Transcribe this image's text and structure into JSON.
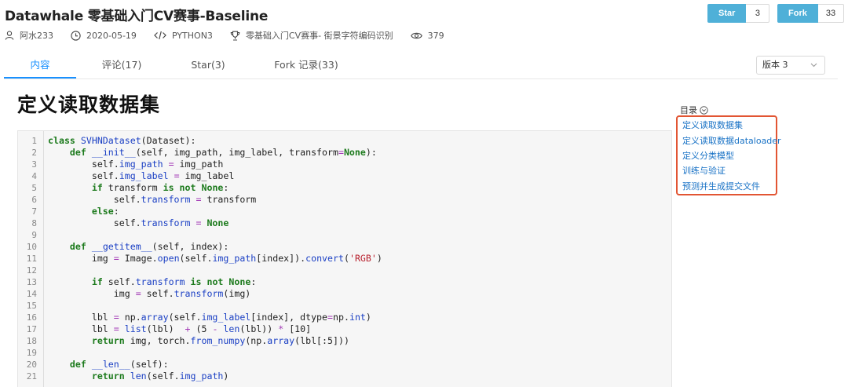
{
  "header": {
    "title": "Datawhale 零基础入门CV赛事-Baseline",
    "star_label": "Star",
    "star_count": "3",
    "fork_label": "Fork",
    "fork_count": "33"
  },
  "meta": {
    "author": "阿水233",
    "date": "2020-05-19",
    "language": "PYTHON3",
    "competition": "零基础入门CV赛事- 街景字符编码识别",
    "views": "379"
  },
  "tabs": [
    {
      "label": "内容",
      "active": true
    },
    {
      "label": "评论(17)",
      "active": false
    },
    {
      "label": "Star(3)",
      "active": false
    },
    {
      "label": "Fork 记录(33)",
      "active": false
    }
  ],
  "version_select": {
    "value": "版本 3"
  },
  "section_heading": "定义读取数据集",
  "toc": {
    "title": "目录",
    "items": [
      "定义读取数据集",
      "定义读取数据dataloader",
      "定义分类模型",
      "训练与验证",
      "预测并生成提交文件"
    ]
  },
  "code": {
    "line_numbers": [
      "1",
      "2",
      "3",
      "4",
      "5",
      "6",
      "7",
      "8",
      "9",
      "10",
      "11",
      "12",
      "13",
      "14",
      "15",
      "16",
      "17",
      "18",
      "19",
      "20",
      "21"
    ],
    "lines": [
      "class SVHNDataset(Dataset):",
      "    def __init__(self, img_path, img_label, transform=None):",
      "        self.img_path = img_path",
      "        self.img_label = img_label",
      "        if transform is not None:",
      "            self.transform = transform",
      "        else:",
      "            self.transform = None",
      "",
      "    def __getitem__(self, index):",
      "        img = Image.open(self.img_path[index]).convert('RGB')",
      "",
      "        if self.transform is not None:",
      "            img = self.transform(img)",
      "",
      "        lbl = np.array(self.img_label[index], dtype=np.int)",
      "        lbl = list(lbl)  + (5 - len(lbl)) * [10]",
      "        return img, torch.from_numpy(np.array(lbl[:5]))",
      "",
      "    def __len__(self):",
      "        return len(self.img_path)"
    ]
  },
  "colors": {
    "accent_blue": "#1890ff",
    "button_blue": "#4fb0d8",
    "toc_highlight": "#e25533",
    "keyword_green": "#1c7a1c"
  },
  "icons": [
    "user-icon",
    "clock-icon",
    "code-icon",
    "trophy-icon",
    "eye-icon",
    "chevron-down-icon",
    "circle-chevron-icon"
  ]
}
